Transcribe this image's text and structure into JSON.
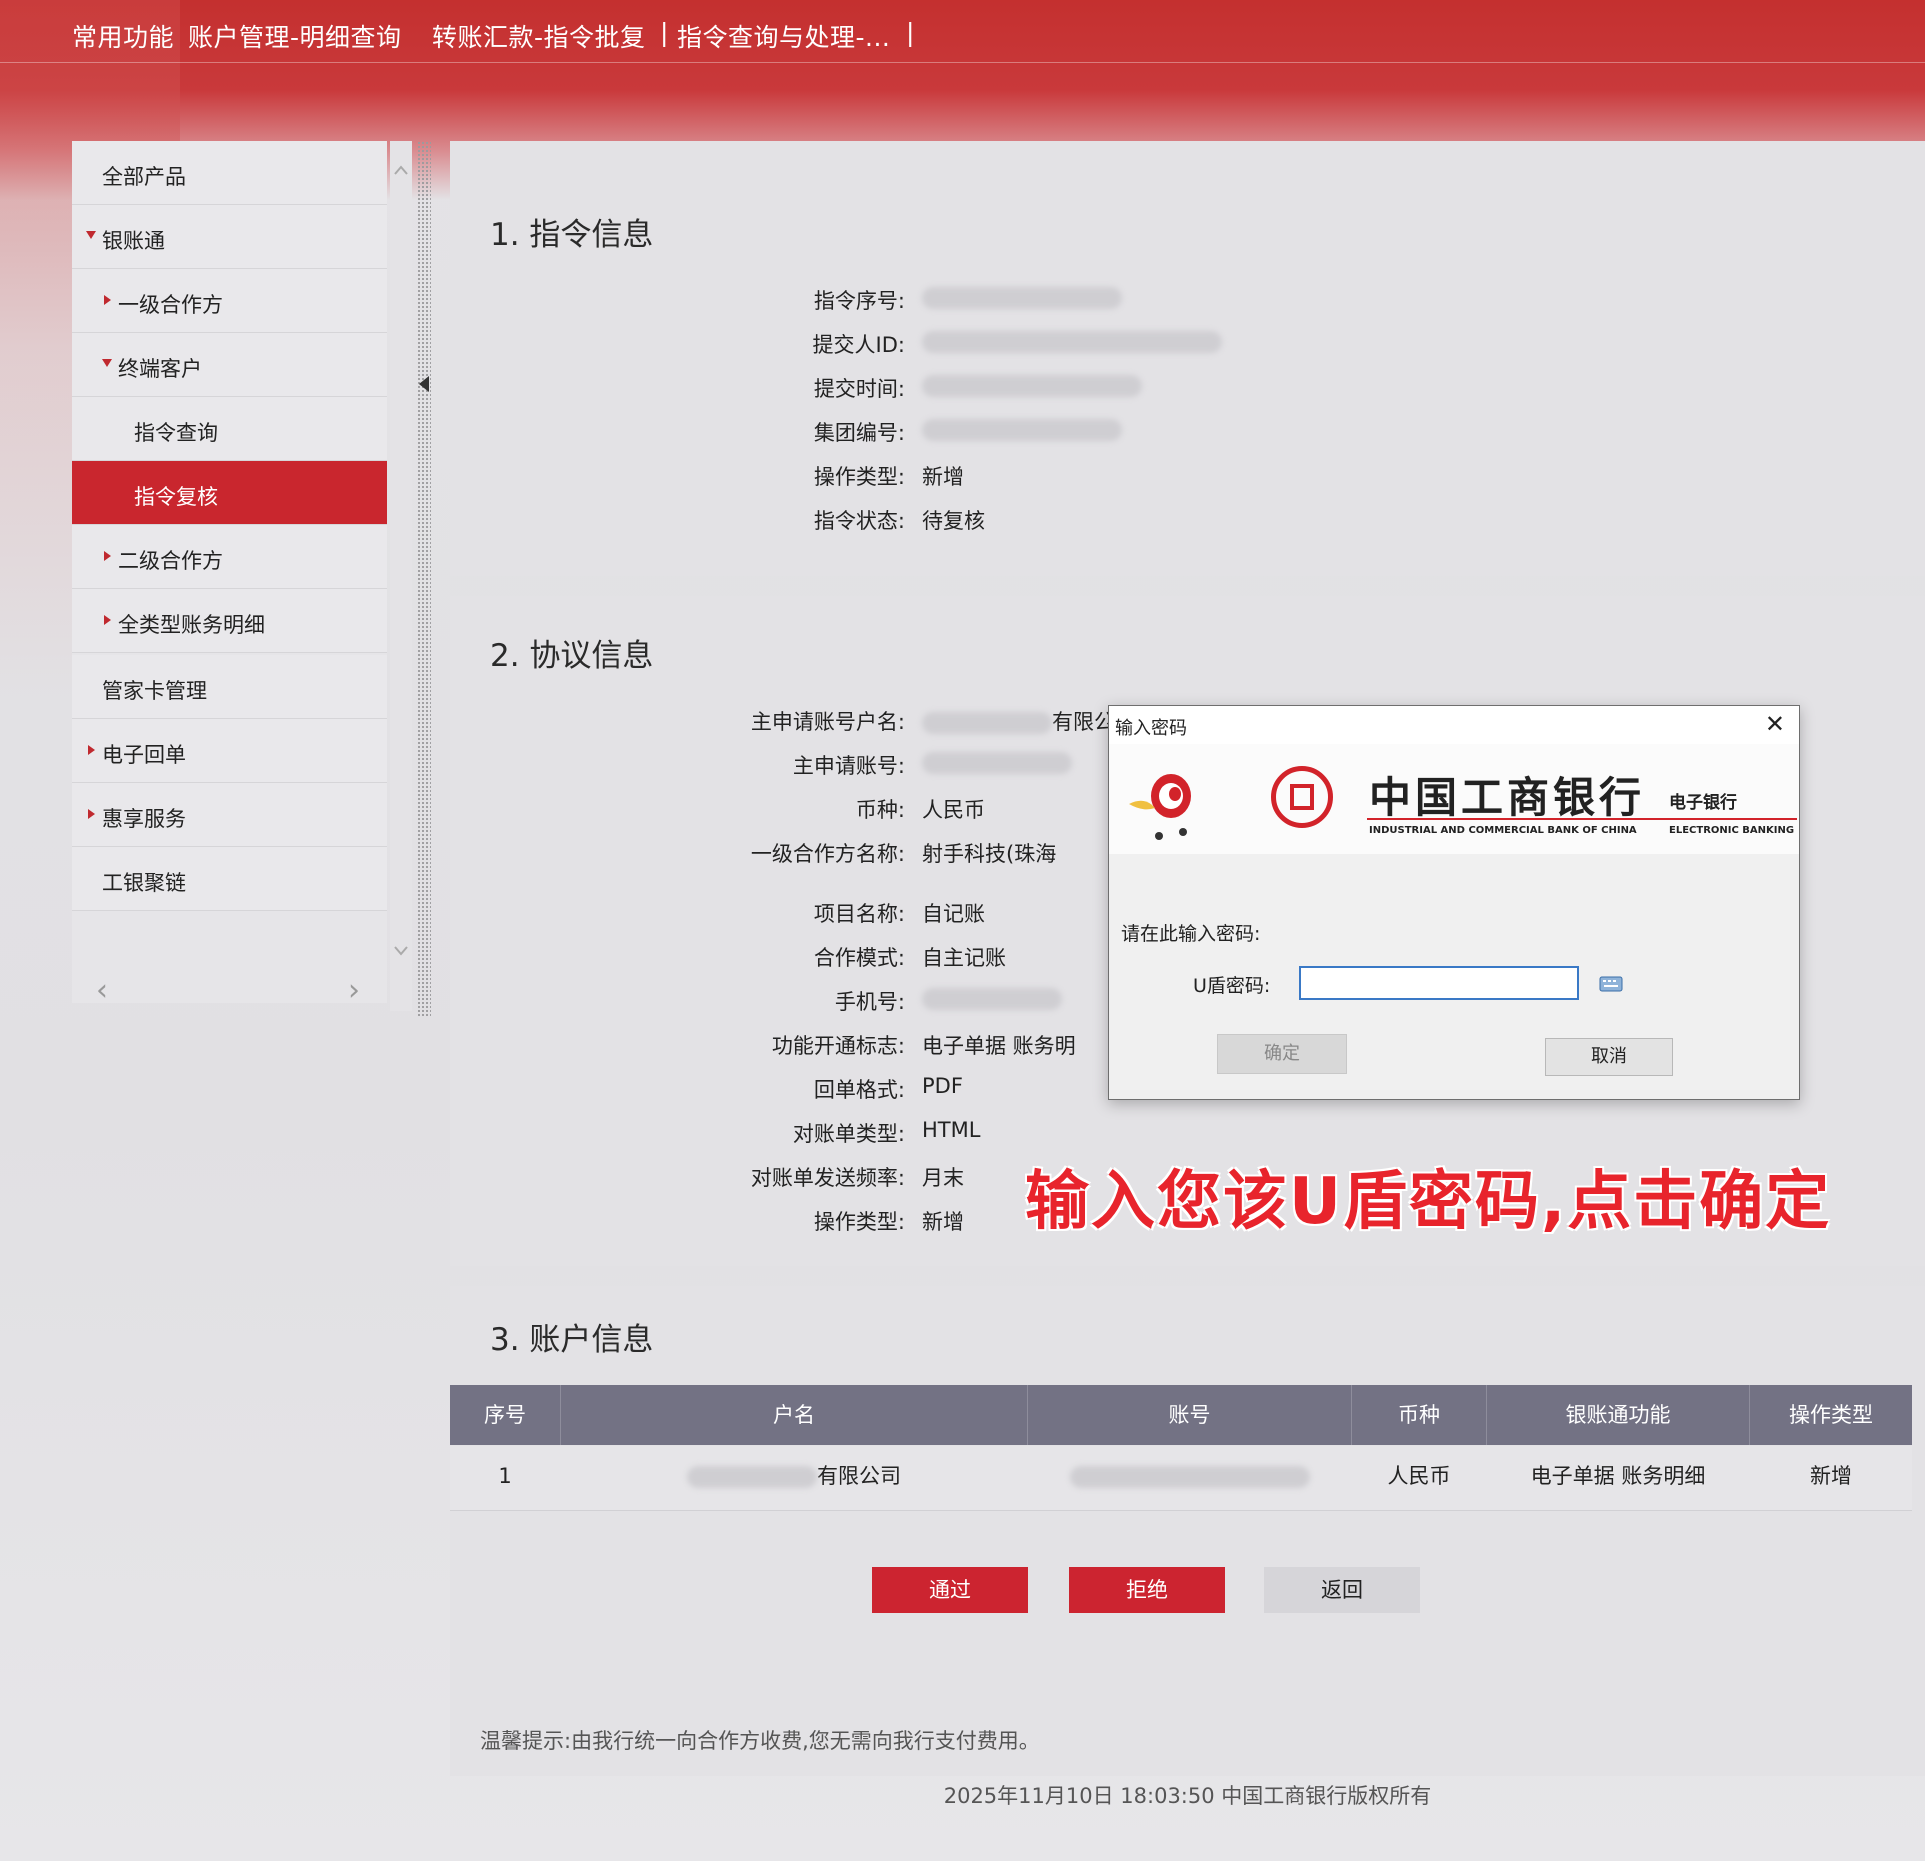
{
  "colors": {
    "brand_red": "#c9262e",
    "table_header": "#737284",
    "overlay_red": "#e8242c"
  },
  "topnav": {
    "items": [
      "常用功能",
      "账户管理-明细查询",
      "转账汇款-指令批复",
      "|",
      "指令查询与处理-...",
      "|"
    ]
  },
  "sidebar": {
    "items": [
      {
        "label": "全部产品"
      },
      {
        "label": "银账通"
      },
      {
        "label": "一级合作方"
      },
      {
        "label": "终端客户"
      },
      {
        "label": "指令查询"
      },
      {
        "label": "指令复核"
      },
      {
        "label": "二级合作方"
      },
      {
        "label": "全类型账务明细"
      },
      {
        "label": "管家卡管理"
      },
      {
        "label": "电子回单"
      },
      {
        "label": "惠享服务"
      },
      {
        "label": "工银聚链"
      }
    ],
    "scroll_left": "‹",
    "scroll_right": "›"
  },
  "section1": {
    "title": "1. 指令信息",
    "fields": [
      {
        "label": "指令序号:",
        "value": ""
      },
      {
        "label": "提交人ID:",
        "value": ""
      },
      {
        "label": "提交时间:",
        "value": ""
      },
      {
        "label": "集团编号:",
        "value": ""
      },
      {
        "label": "操作类型:",
        "value": "新增"
      },
      {
        "label": "指令状态:",
        "value": "待复核"
      }
    ]
  },
  "section2": {
    "title": "2. 协议信息",
    "fields": [
      {
        "label": "主申请账号户名:",
        "value": "有限公"
      },
      {
        "label": "主申请账号:",
        "value": ""
      },
      {
        "label": "币种:",
        "value": "人民币"
      },
      {
        "label": "一级合作方名称:",
        "value": "射手科技(珠海"
      },
      {
        "label": "项目名称:",
        "value": "自记账"
      },
      {
        "label": "合作模式:",
        "value": "自主记账"
      },
      {
        "label": "手机号:",
        "value": ""
      },
      {
        "label": "功能开通标志:",
        "value": "电子单据 账务明"
      },
      {
        "label": "回单格式:",
        "value": "PDF"
      },
      {
        "label": "对账单类型:",
        "value": "HTML"
      },
      {
        "label": "对账单发送频率:",
        "value": "月末"
      },
      {
        "label": "操作类型:",
        "value": "新增"
      }
    ]
  },
  "section3": {
    "title": "3. 账户信息",
    "headers": [
      "序号",
      "户名",
      "账号",
      "币种",
      "银账通功能",
      "操作类型"
    ],
    "rows": [
      {
        "index": "1",
        "name": "有限公司",
        "account": "",
        "currency": "人民币",
        "function": "电子单据 账务明细",
        "op": "新增"
      }
    ]
  },
  "buttons": {
    "approve": "通过",
    "reject": "拒绝",
    "back": "返回"
  },
  "hint": "温馨提示:由我行统一向合作方收费,您无需向我行支付费用。",
  "footer": "2025年11月10日 18:03:50   中国工商银行版权所有",
  "dialog": {
    "title": "输入密码",
    "close": "✕",
    "bank_name_cn": "中国工商银行",
    "bank_name_en": "INDUSTRIAL AND COMMERCIAL BANK OF CHINA",
    "ebank_cn": "电子银行",
    "ebank_en": "ELECTRONIC BANKING",
    "prompt": "请在此输入密码:",
    "password_label": "U盾密码:",
    "password_value": "",
    "ok": "确定",
    "cancel": "取消"
  },
  "overlay_text": "输入您该U盾密码,点击确定"
}
